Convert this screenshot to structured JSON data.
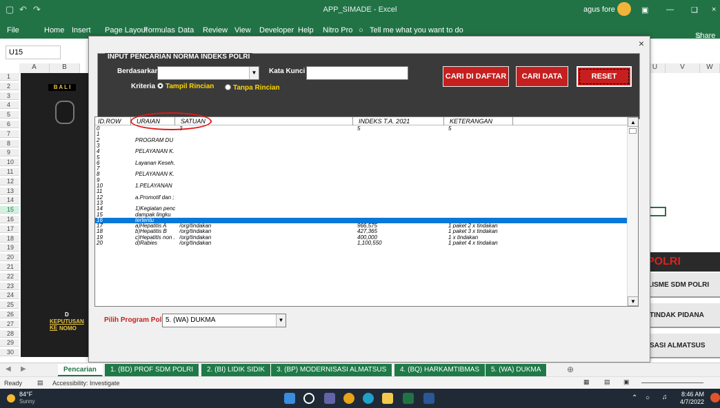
{
  "window": {
    "title": "APP_SIMADE  -  Excel",
    "user": "agus fore",
    "share_label": "Share"
  },
  "ribbon": {
    "tabs": [
      "File",
      "Home",
      "Insert",
      "Page Layout",
      "Formulas",
      "Data",
      "Review",
      "View",
      "Developer",
      "Help",
      "Nitro Pro",
      "Tell me what you want to do"
    ]
  },
  "formula": {
    "namebox": "U15"
  },
  "columns": [
    "A",
    "B",
    "U",
    "V",
    "W"
  ],
  "rows": [
    "1",
    "2",
    "3",
    "4",
    "5",
    "6",
    "7",
    "8",
    "9",
    "10",
    "11",
    "12",
    "13",
    "14",
    "15",
    "16",
    "17",
    "18",
    "19",
    "20",
    "21",
    "22",
    "23",
    "24",
    "25",
    "26",
    "27",
    "28",
    "29",
    "30"
  ],
  "sheet": {
    "left_texts": [
      "B A L I",
      "D",
      "KEPUTUSAN KE",
      "NOMO"
    ],
    "polri": "POLRI",
    "right_buttons": [
      "ALISME SDM POLRI",
      "K TINDAK PIDANA",
      "NISASI ALMATSUS"
    ]
  },
  "dialog": {
    "close": "×",
    "frame_title": "INPUT PENCARIAN NORMA INDEKS POLRI",
    "berdasarkan_label": "Berdasarkan",
    "kata_kunci_label": "Kata Kunci",
    "kriteria_label": "Kriteria",
    "radio_rincian": "Tampil Rincian",
    "radio_tanpa": "Tanpa Rincian",
    "btn_cari_daftar": "CARI DI DAFTAR",
    "btn_cari_data": "CARI DATA",
    "btn_reset": "RESET",
    "program_label": "Pilih Program Polri",
    "program_value": "5. (WA) DUKMA"
  },
  "list": {
    "headers": [
      "ID.ROW",
      "URAIAN",
      "SATUAN",
      "INDEKS T.A. 2021",
      "KETERANGAN"
    ],
    "rows": [
      {
        "id": "0",
        "uraian": "",
        "satuan": "3",
        "indeks": "5",
        "ket": "5"
      },
      {
        "id": "1",
        "uraian": "",
        "satuan": "",
        "indeks": "",
        "ket": ""
      },
      {
        "id": "2",
        "uraian": "PROGRAM  DU",
        "satuan": "",
        "indeks": "",
        "ket": ""
      },
      {
        "id": "3",
        "uraian": "",
        "satuan": "",
        "indeks": "",
        "ket": ""
      },
      {
        "id": "4",
        "uraian": "PELAYANAN K.",
        "satuan": "",
        "indeks": "",
        "ket": ""
      },
      {
        "id": "5",
        "uraian": "",
        "satuan": "",
        "indeks": "",
        "ket": ""
      },
      {
        "id": "6",
        "uraian": "Layanan Keseh.",
        "satuan": "",
        "indeks": "",
        "ket": ""
      },
      {
        "id": "7",
        "uraian": "",
        "satuan": "",
        "indeks": "",
        "ket": ""
      },
      {
        "id": "8",
        "uraian": "PELAYANAN K.",
        "satuan": "",
        "indeks": "",
        "ket": ""
      },
      {
        "id": "9",
        "uraian": "",
        "satuan": "",
        "indeks": "",
        "ket": ""
      },
      {
        "id": "10",
        "uraian": "1.PELAYANAN",
        "satuan": "",
        "indeks": "",
        "ket": ""
      },
      {
        "id": "11",
        "uraian": "",
        "satuan": "",
        "indeks": "",
        "ket": ""
      },
      {
        "id": "12",
        "uraian": "a.Promotif dan ;",
        "satuan": "",
        "indeks": "",
        "ket": ""
      },
      {
        "id": "13",
        "uraian": "",
        "satuan": "",
        "indeks": "",
        "ket": ""
      },
      {
        "id": "14",
        "uraian": "1)Kegiatan penc",
        "satuan": "",
        "indeks": "",
        "ket": ""
      },
      {
        "id": "15",
        "uraian": "dampak   lingku",
        "satuan": "",
        "indeks": "",
        "ket": ""
      },
      {
        "id": "16",
        "uraian": "tertentu",
        "satuan": "",
        "indeks": "",
        "ket": ""
      },
      {
        "id": "17",
        "uraian": "a)Hepatitis A",
        "satuan": "/org/tindakan",
        "indeks": "966,575",
        "ket": "1 paket 2 x tindakan"
      },
      {
        "id": "18",
        "uraian": "b)Hepatitis B",
        "satuan": "/org/tindakan",
        "indeks": "427,365",
        "ket": "1 paket 3 x tindakan"
      },
      {
        "id": "19",
        "uraian": "c)Hepatitis non .",
        "satuan": "/org/tindakan",
        "indeks": "400,000",
        "ket": "1 x tindakan"
      },
      {
        "id": "20",
        "uraian": "d)Rabies",
        "satuan": "/org/tindakan",
        "indeks": "1,100,550",
        "ket": "1 paket 4 x tindakan"
      }
    ]
  },
  "sheettabs": [
    "Pencarian",
    "1. (BD) PROF SDM POLRI",
    "2. (BI) LIDIK SIDIK",
    "3. (BP) MODERNISASI ALMATSUS",
    "4. (BQ) HARKAMTIBMAS",
    "5. (WA) DUKMA"
  ],
  "status": {
    "ready": "Ready",
    "accessibility": "Accessibility: Investigate"
  },
  "taskbar": {
    "temp": "84°F",
    "weather": "Sunny",
    "time": "8:46 AM",
    "date": "4/7/2022"
  }
}
